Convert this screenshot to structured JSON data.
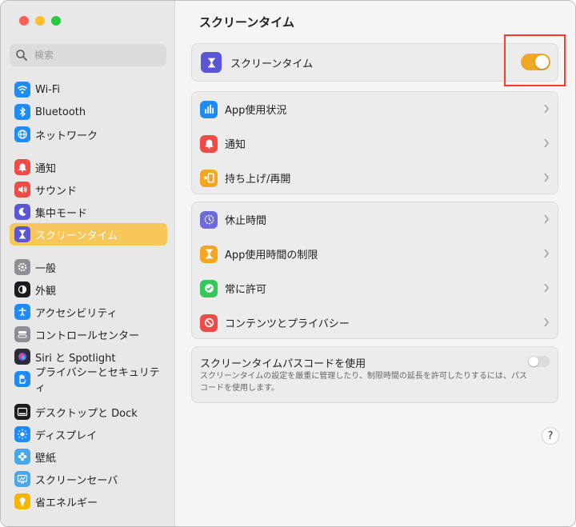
{
  "window": {
    "title": "スクリーンタイム"
  },
  "sidebar": {
    "search": {
      "placeholder": "検索",
      "value": ""
    },
    "groups": [
      [
        {
          "label": "Wi-Fi",
          "icon": "wifi-icon",
          "color": "#1f8bf6"
        },
        {
          "label": "Bluetooth",
          "icon": "bluetooth-icon",
          "color": "#1f8bf6"
        },
        {
          "label": "ネットワーク",
          "icon": "globe-icon",
          "color": "#1f8bf6"
        }
      ],
      [
        {
          "label": "通知",
          "icon": "bell-icon",
          "color": "#f04b47"
        },
        {
          "label": "サウンド",
          "icon": "speaker-icon",
          "color": "#f04b47"
        },
        {
          "label": "集中モード",
          "icon": "moon-icon",
          "color": "#5b56d6"
        },
        {
          "label": "スクリーンタイム",
          "icon": "hourglass-icon",
          "color": "#5b56d6",
          "selected": true
        }
      ],
      [
        {
          "label": "一般",
          "icon": "gear-icon",
          "color": "#8e8e93"
        },
        {
          "label": "外観",
          "icon": "appearance-icon",
          "color": "#1c1c1e"
        },
        {
          "label": "アクセシビリティ",
          "icon": "accessibility-icon",
          "color": "#1f8bf6"
        },
        {
          "label": "コントロールセンター",
          "icon": "control-center-icon",
          "color": "#8e8e93"
        },
        {
          "label": "Siri と Spotlight",
          "icon": "siri-icon",
          "color": "#2b2b3a"
        },
        {
          "label": "プライバシーとセキュリティ",
          "icon": "hand-icon",
          "color": "#1f8bf6"
        }
      ],
      [
        {
          "label": "デスクトップと Dock",
          "icon": "dock-icon",
          "color": "#1c1c1e"
        },
        {
          "label": "ディスプレイ",
          "icon": "sun-icon",
          "color": "#1f8bf6"
        },
        {
          "label": "壁紙",
          "icon": "flower-icon",
          "color": "#4aa8e8"
        },
        {
          "label": "スクリーンセーバ",
          "icon": "screensaver-icon",
          "color": "#4aa8e8"
        },
        {
          "label": "省エネルギー",
          "icon": "bulb-icon",
          "color": "#f7b500"
        }
      ]
    ]
  },
  "main": {
    "title": "スクリーンタイム",
    "master": {
      "label": "スクリーンタイム",
      "icon": "hourglass-icon",
      "enabled": true
    },
    "usage_group": [
      {
        "label": "App使用状況",
        "icon": "chart-icon",
        "color": "#1f8bf6"
      },
      {
        "label": "通知",
        "icon": "bell-icon",
        "color": "#f04b47"
      },
      {
        "label": "持ち上げ/再開",
        "icon": "pickup-icon",
        "color": "#f5a623"
      }
    ],
    "limits_group": [
      {
        "label": "休止時間",
        "icon": "downtime-icon",
        "color": "#6e6bd8"
      },
      {
        "label": "App使用時間の制限",
        "icon": "hourglass-icon",
        "color": "#f5a623"
      },
      {
        "label": "常に許可",
        "icon": "checkmark-shield-icon",
        "color": "#34c759"
      },
      {
        "label": "コンテンツとプライバシー",
        "icon": "restricted-icon",
        "color": "#f04b47"
      }
    ],
    "passcode": {
      "title": "スクリーンタイムパスコードを使用",
      "description": "スクリーンタイムの設定を厳重に管理したり、制限時間の延長を許可したりするには、パスコードを使用します。",
      "enabled": false
    },
    "help_label": "?"
  },
  "colors": {
    "accent": "#f0a829",
    "selection": "#f7c75b",
    "highlight_box": "#ff3b30"
  }
}
